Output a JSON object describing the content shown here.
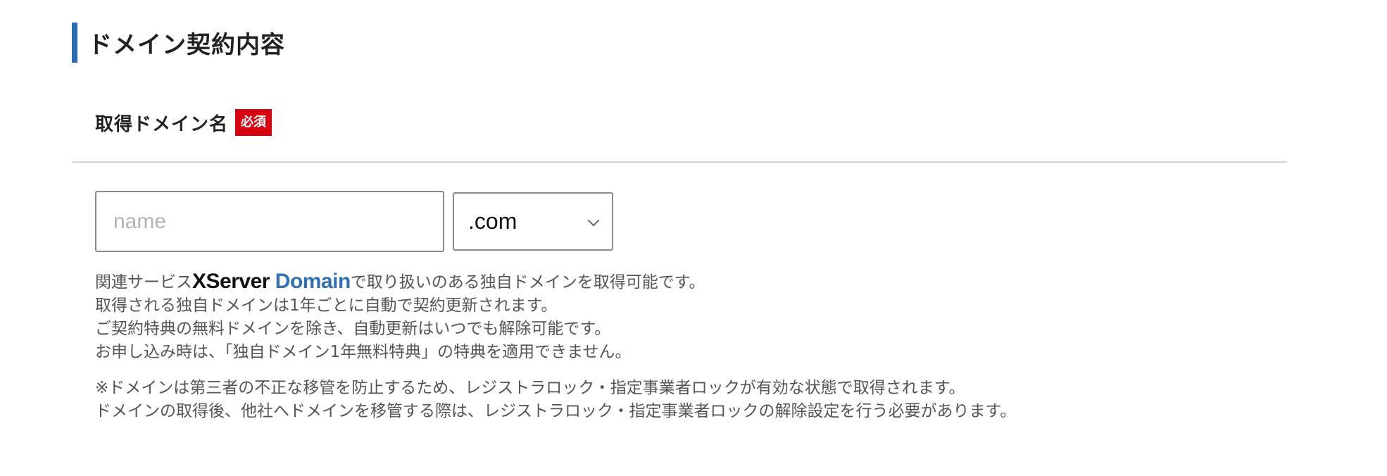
{
  "section": {
    "title": "ドメイン契約内容",
    "accent_color": "#2a6bb5"
  },
  "field": {
    "label": "取得ドメイン名",
    "required_badge": "必須",
    "required_color": "#d7000f"
  },
  "domain_input": {
    "placeholder": "name",
    "value": ""
  },
  "tld_select": {
    "selected": ".com"
  },
  "notes": {
    "line1_prefix": "関連サービス",
    "brand_x": "XServer",
    "brand_domain": "Domain",
    "line1_suffix": "で取り扱いのある独自ドメインを取得可能です。",
    "line2": "取得される独自ドメインは1年ごとに自動で契約更新されます。",
    "line3": "ご契約特典の無料ドメインを除き、自動更新はいつでも解除可能です。",
    "line4": "お申し込み時は、「独自ドメイン1年無料特典」の特典を適用できません。"
  },
  "caution": {
    "line1": "※ドメインは第三者の不正な移管を防止するため、レジストラロック・指定事業者ロックが有効な状態で取得されます。",
    "line2": "ドメインの取得後、他社へドメインを移管する際は、レジストラロック・指定事業者ロックの解除設定を行う必要があります。"
  }
}
